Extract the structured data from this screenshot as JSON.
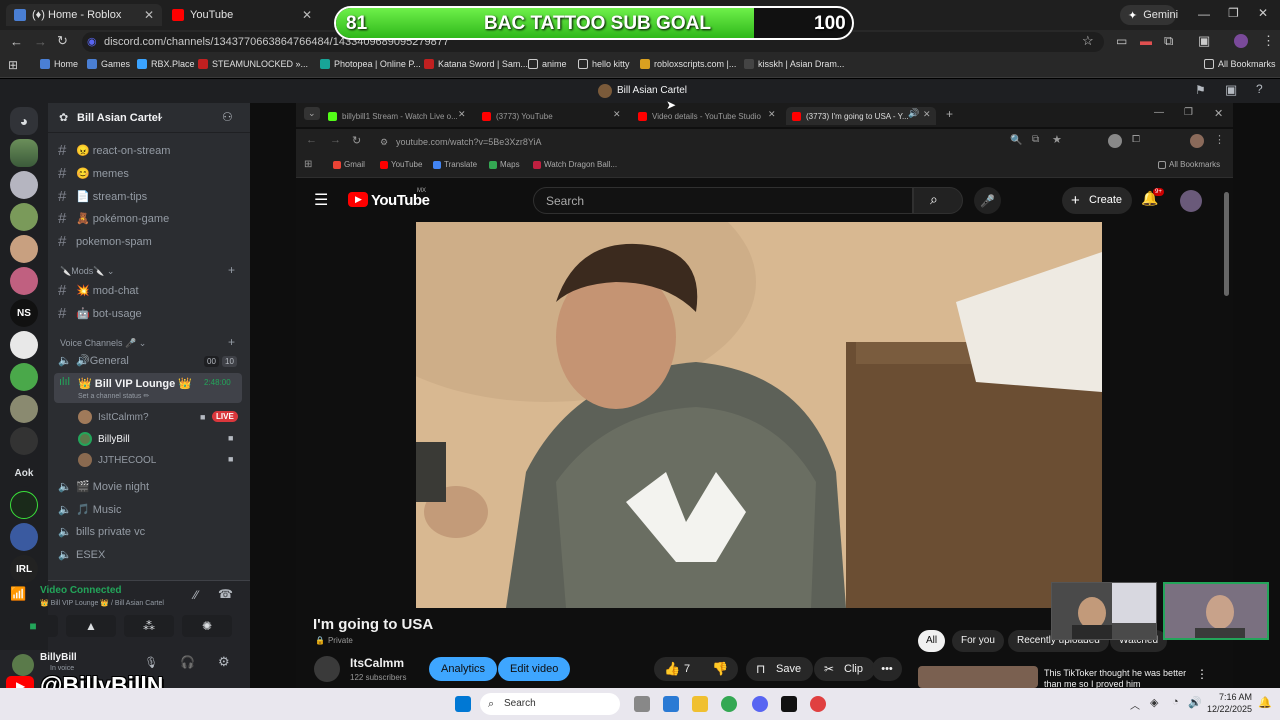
{
  "chrome": {
    "tabs": [
      {
        "label": "(♦) Home - Roblox"
      },
      {
        "label": "YouTube"
      }
    ],
    "url": "discord.com/channels/1343770663864766484/1433409689095279877",
    "gemini": "Gemini",
    "bookmarks": [
      "Home",
      "Games",
      "RBX.Place",
      "STEAMUNLOCKED »...",
      "Photopea | Online P...",
      "Katana Sword | Sam...",
      "anime",
      "hello kitty",
      "robloxscripts.com |...",
      "kisskh | Asian Dram..."
    ],
    "all_bookmarks": "All Bookmarks"
  },
  "goal": {
    "current": "81",
    "label": "BAC TATTOO SUB GOAL",
    "target": "100",
    "progress": 0.81
  },
  "discord": {
    "window_title": "Bill Asian Cartel",
    "server_name": "Bill Asian Cartel",
    "guild_labels": [
      "NS",
      "Aok",
      "IRL"
    ],
    "channels": [
      {
        "name": "😠 react-on-stream"
      },
      {
        "name": "😊 memes"
      },
      {
        "name": "📄 stream-tips"
      },
      {
        "name": "🧸 pokémon-game"
      },
      {
        "name": "pokemon-spam"
      }
    ],
    "mods_category": "🔪Mods🔪",
    "mod_channels": [
      {
        "name": "💥 mod-chat"
      },
      {
        "name": "🤖 bot-usage"
      }
    ],
    "voice_category": "Voice Channels 🎤",
    "voice_channels": [
      {
        "name": "🔊General",
        "counts": [
          "00",
          "10"
        ]
      },
      {
        "name": "👑 Bill VIP Lounge 👑",
        "time": "2:48:00",
        "status": "Set a channel status ✏"
      }
    ],
    "voice_users": [
      {
        "name": "IsItCalmm?",
        "badge": "LIVE"
      },
      {
        "name": "BillyBill"
      },
      {
        "name": "JJTHECOOL"
      }
    ],
    "more_voice": [
      "🎬 Movie night",
      "🎵 Music",
      "bills private vc",
      "ESEX"
    ],
    "vc_status": "Video Connected",
    "vc_location": "👑 Bill VIP Lounge 👑 / Bill Asian Cartel",
    "user_name": "BillyBill",
    "user_status": "In voice",
    "overlay_handle": "@BillyBillN"
  },
  "inner_browser": {
    "tabs": [
      {
        "label": "billybill1 Stream - Watch Live o..."
      },
      {
        "label": "(3773) YouTube"
      },
      {
        "label": "Video details - YouTube Studio"
      },
      {
        "label": "(3773) I'm going to USA - Y..."
      }
    ],
    "url": "youtube.com/watch?v=5Be3Xzr8YiA",
    "bookmarks": [
      "Gmail",
      "YouTube",
      "Translate",
      "Maps",
      "Watch Dragon Ball..."
    ],
    "all_bookmarks": "All Bookmarks"
  },
  "youtube": {
    "logo": "YouTube",
    "country": "MX",
    "search_placeholder": "Search",
    "create": "Create",
    "notif_count": "9+",
    "video_title": "I'm going to USA",
    "privacy": "Private",
    "channel": "ItsCalmm",
    "subscribers": "122 subscribers",
    "analytics": "Analytics",
    "edit_video": "Edit video",
    "likes": "7",
    "save": "Save",
    "clip": "Clip",
    "filters": [
      "All",
      "For you",
      "Recently uploaded",
      "Watched"
    ],
    "rec_title": "This TikToker thought he was better than me so I proved him"
  },
  "taskbar": {
    "search": "Search",
    "time": "7:16 AM",
    "date": "12/22/2025"
  },
  "colors": {
    "goal_fill": "#4cd62a",
    "discord_green": "#23a55a",
    "live_red": "#da373c",
    "yt_blue": "#3ea6ff"
  }
}
